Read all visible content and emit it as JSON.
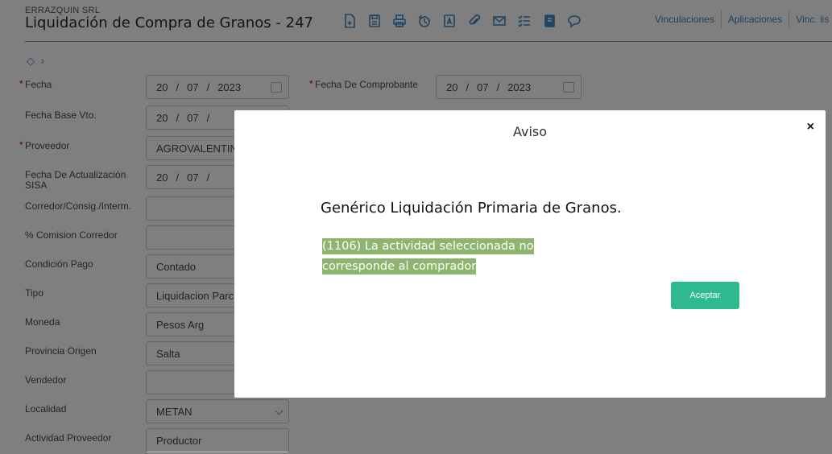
{
  "header": {
    "company": "ERRAZQUIN SRL",
    "title": "Liquidación de Compra de Granos - 247",
    "links": [
      "Vinculaciones",
      "Aplicaciones",
      "Vinc. lis"
    ]
  },
  "toolbar_icons": [
    "new-document-icon",
    "save-icon",
    "print-icon",
    "history-icon",
    "text-document-icon",
    "attach-icon",
    "email-icon",
    "checklist-icon",
    "notebook-icon",
    "comment-icon"
  ],
  "form": {
    "fecha": {
      "label": "Fecha",
      "required": true,
      "day": "20",
      "month": "07",
      "year": "2023"
    },
    "fecha_comprobante": {
      "label": "Fecha De Comprobante",
      "required": true,
      "day": "20",
      "month": "07",
      "year": "2023"
    },
    "fecha_base_vto": {
      "label": "Fecha Base Vto.",
      "day": "20",
      "month": "07"
    },
    "proveedor": {
      "label": "Proveedor",
      "required": true,
      "value": "AGROVALENTIN"
    },
    "fecha_sisa": {
      "label": "Fecha De Actualización SISA",
      "day": "20",
      "month": "07"
    },
    "corredor": {
      "label": "Corredor/Consig./Interm.",
      "value": ""
    },
    "comision": {
      "label": "% Comision Corredor",
      "value": ""
    },
    "condicion_pago": {
      "label": "Condición Pago",
      "value": "Contado"
    },
    "tipo": {
      "label": "Tipo",
      "value": "Liquidacion Parcial"
    },
    "moneda": {
      "label": "Moneda",
      "value": "Pesos Arg"
    },
    "provincia": {
      "label": "Provincia Origen",
      "value": "Salta"
    },
    "vendedor": {
      "label": "Vendedor",
      "value": ""
    },
    "localidad": {
      "label": "Localidad",
      "value": "METAN"
    },
    "actividad": {
      "label": "Actividad Proveedor",
      "value": "Productor"
    }
  },
  "modal": {
    "title": "Aviso",
    "close": "×",
    "heading": "Genérico Liquidación Primaria de Granos.",
    "message": "(1106) La actividad seleccionada no corresponde al comprador",
    "accept": "Aceptar"
  },
  "colors": {
    "accent": "#3e86c4",
    "accept_button": "#2fb98f",
    "highlight": "#8db56e"
  }
}
